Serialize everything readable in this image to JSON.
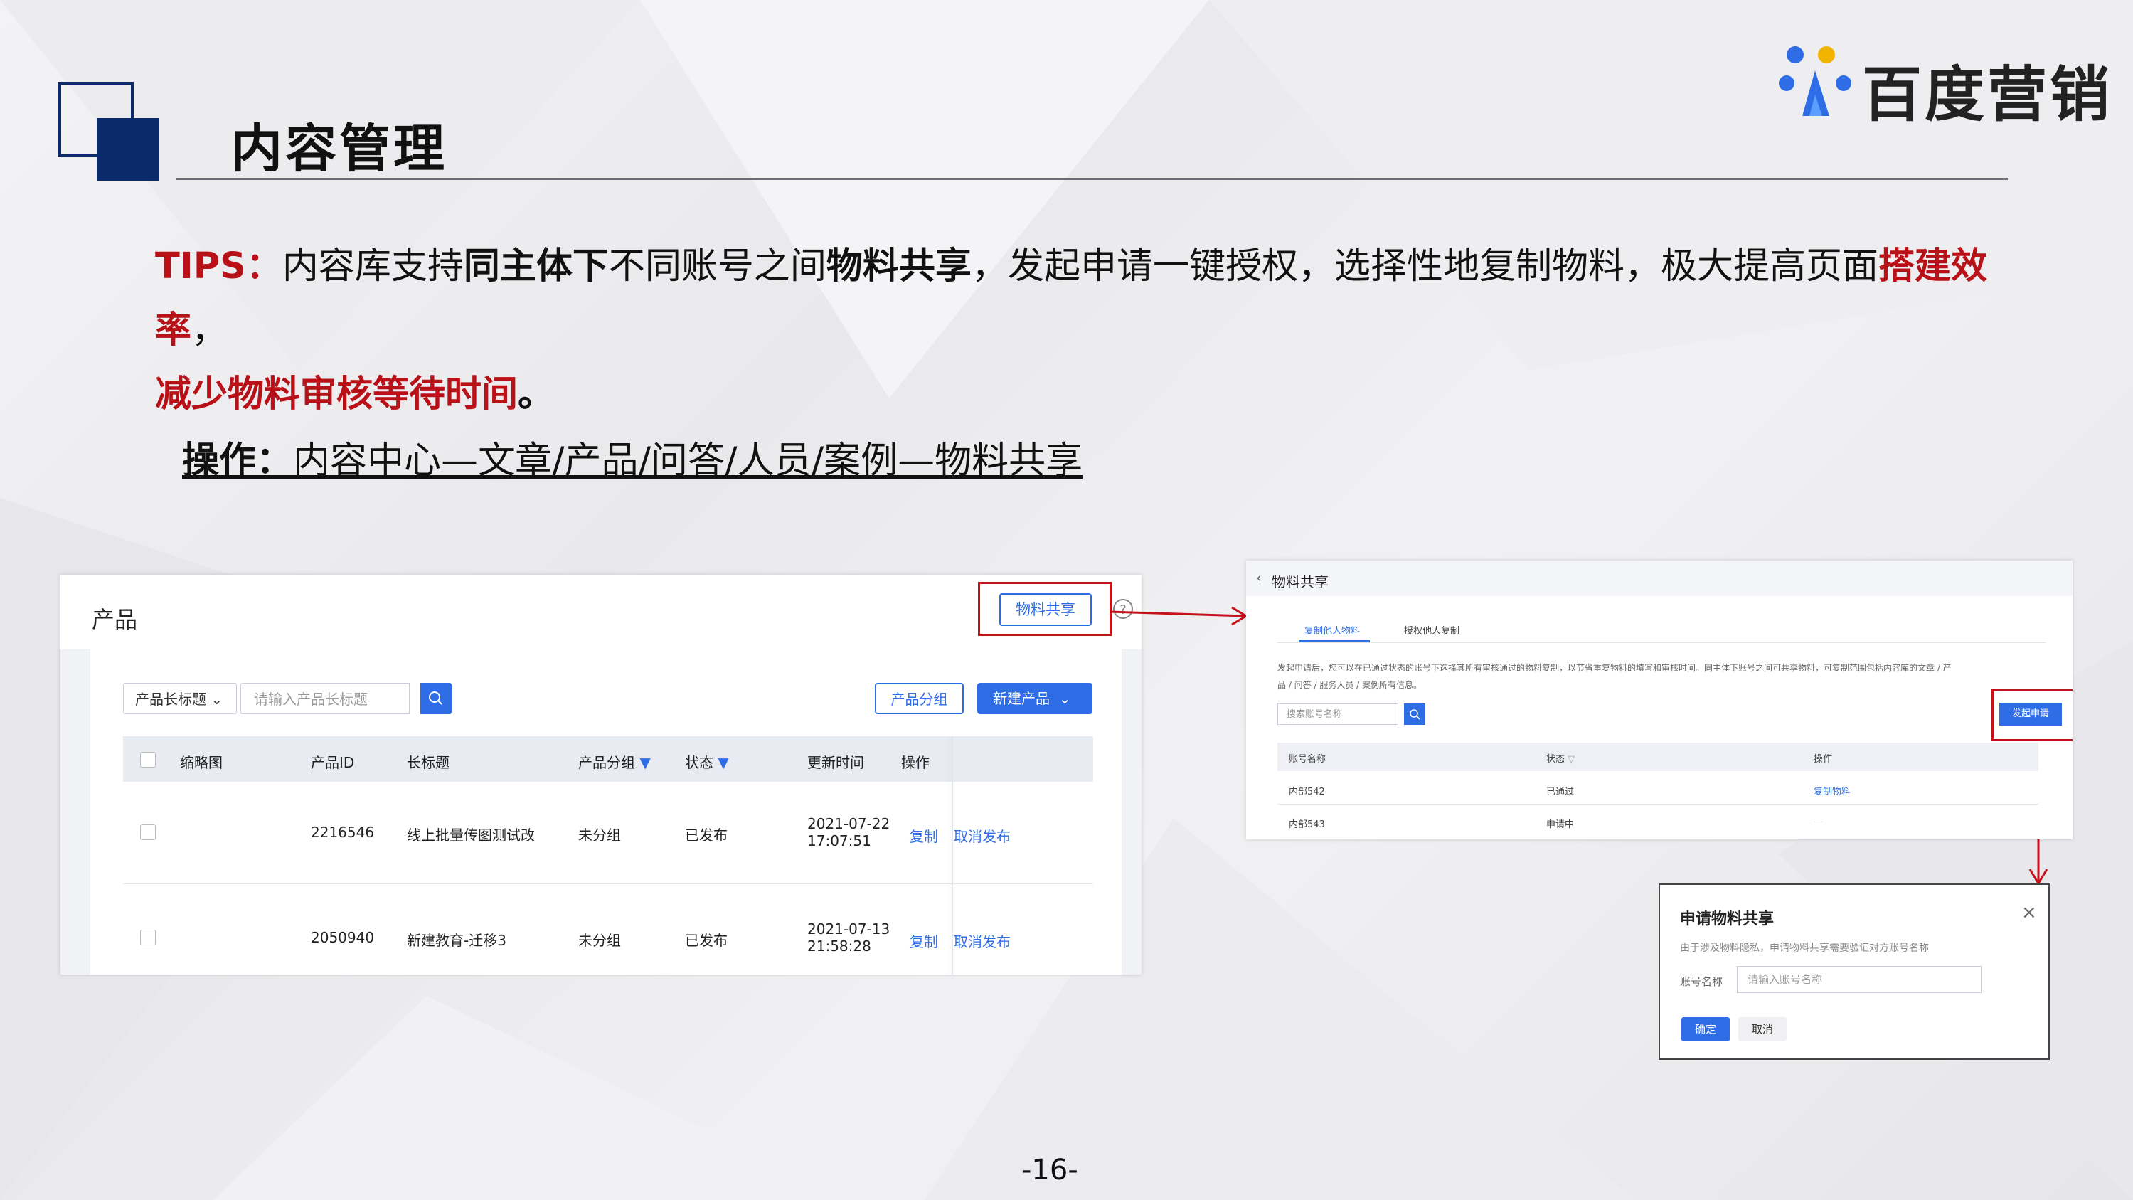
{
  "slide": {
    "title": "内容管理",
    "logo_text": "百度营销",
    "page_number": "-16-",
    "tips": {
      "label": "TIPS：",
      "p1": "内容库支持",
      "p2": "同主体下",
      "p3": "不同账号之间",
      "p4": "物料共享",
      "p5": "，发起申请一键授权，选择性地复制物料，极大提高页面",
      "p6": "搭建效率",
      "p7": "，",
      "p8": "减少物料审核等待时间",
      "p9": "。"
    },
    "operation": {
      "label": "操作：",
      "path": "内容中心—文章/产品/问答/人员/案例—物料共享"
    },
    "colors": {
      "brand_blue": "#0b2a6b",
      "highlight_red": "#b81218",
      "ui_blue": "#2e6de6"
    }
  },
  "product_page": {
    "title": "产品",
    "share_button": "物料共享",
    "help_icon": "?",
    "filter_select": "产品长标题",
    "search_placeholder": "请输入产品长标题",
    "group_button": "产品分组",
    "new_button": "新建产品",
    "columns": [
      "缩略图",
      "产品ID",
      "长标题",
      "产品分组",
      "状态",
      "更新时间",
      "操作"
    ],
    "rows": [
      {
        "id": "2216546",
        "title": "线上批量传图测试改",
        "group": "未分组",
        "status": "已发布",
        "date": "2021-07-22",
        "time": "17:07:51",
        "action1": "复制",
        "action2": "取消发布"
      },
      {
        "id": "2050940",
        "title": "新建教育-迁移3",
        "group": "未分组",
        "status": "已发布",
        "date": "2021-07-13",
        "time": "21:58:28",
        "action1": "复制",
        "action2": "取消发布"
      }
    ]
  },
  "share_page": {
    "back": "‹",
    "title": "物料共享",
    "tabs": [
      "复制他人物料",
      "授权他人复制"
    ],
    "desc1": "发起申请后，您可以在已通过状态的账号下选择其所有审核通过的物料复制，以节省重复物料的填写和审核时间。同主体下账号之间可共享物料，可复制范围包括内容库的文章 / 产",
    "desc2": "品 / 问答 / 服务人员 / 案例所有信息。",
    "search_placeholder": "搜索账号名称",
    "apply_button": "发起申请",
    "columns": [
      "账号名称",
      "状态",
      "操作"
    ],
    "rows": [
      {
        "name": "内部542",
        "status": "已通过",
        "action": "复制物料"
      },
      {
        "name": "内部543",
        "status": "申请中",
        "action": "—"
      }
    ]
  },
  "apply_dialog": {
    "title": "申请物料共享",
    "hint": "由于涉及物料隐私，申请物料共享需要验证对方账号名称",
    "field_label": "账号名称",
    "field_placeholder": "请输入账号名称",
    "confirm": "确定",
    "cancel": "取消",
    "close": "×"
  }
}
